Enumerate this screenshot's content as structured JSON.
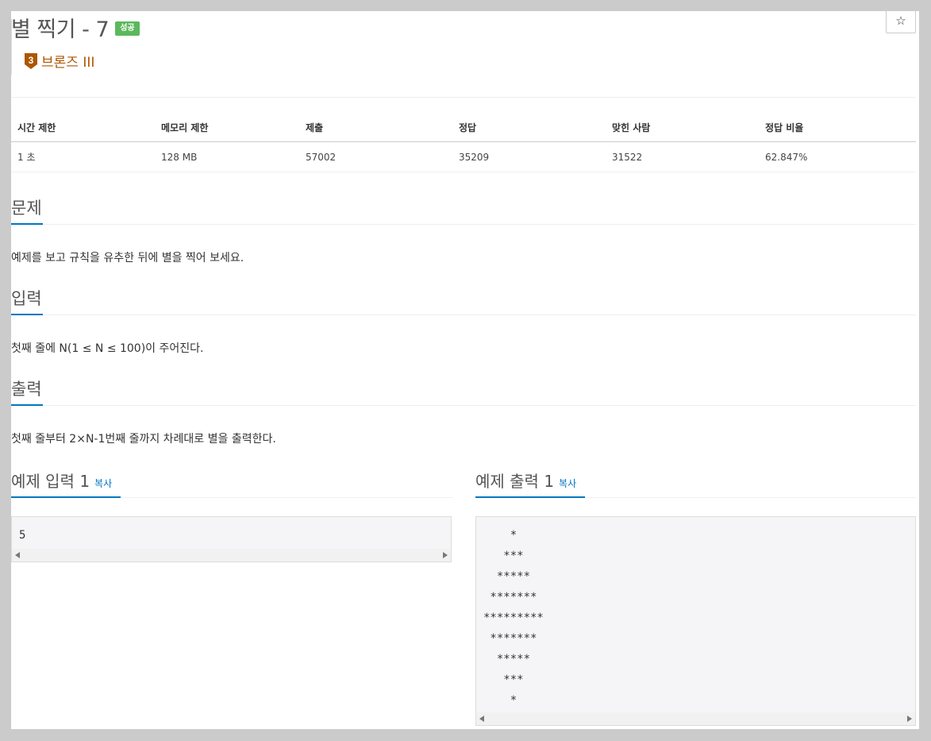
{
  "problem": {
    "title": "별 찍기 - 7",
    "status_badge": "성공",
    "tier_number": "3",
    "tier_label": "브론즈 III",
    "star_glyph": "☆"
  },
  "info_table": {
    "headers": [
      "시간 제한",
      "메모리 제한",
      "제출",
      "정답",
      "맞힌 사람",
      "정답 비율"
    ],
    "values": [
      "1 초",
      "128 MB",
      "57002",
      "35209",
      "31522",
      "62.847%"
    ]
  },
  "sections": {
    "problem": {
      "heading": "문제",
      "text": "예제를 보고 규칙을 유추한 뒤에 별을 찍어 보세요."
    },
    "input": {
      "heading": "입력",
      "text": "첫째 줄에 N(1 ≤ N ≤ 100)이 주어진다."
    },
    "output": {
      "heading": "출력",
      "text": "첫째 줄부터 2×N-1번째 줄까지 차례대로 별을 출력한다."
    }
  },
  "samples": {
    "input": {
      "heading": "예제 입력 1",
      "copy_label": "복사",
      "content": "5"
    },
    "output": {
      "heading": "예제 출력 1",
      "copy_label": "복사",
      "content": "    *\n   ***\n  *****\n *******\n*********\n *******\n  *****\n   ***\n    *"
    }
  },
  "colors": {
    "accent": "#0076c0",
    "success": "#5cb85c",
    "tier_bronze": "#ad5600"
  }
}
